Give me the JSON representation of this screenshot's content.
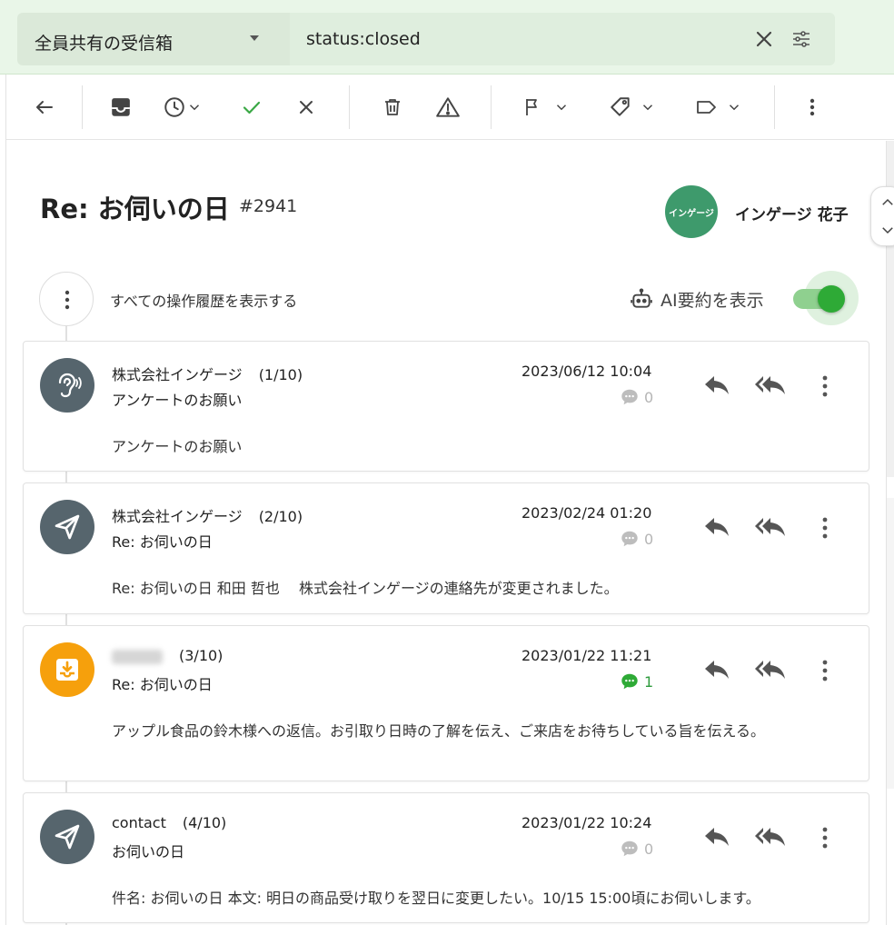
{
  "search": {
    "inbox": "全員共有の受信箱",
    "query": "status:closed"
  },
  "ticket": {
    "title": "Re: お伺いの日",
    "number": "#2941",
    "assignee_badge": "インゲージ",
    "assignee_name": "インゲージ 花子"
  },
  "timeline": {
    "history_label": "すべての操作履歴を表示する",
    "ai_label": "AI要約を表示",
    "ai_enabled": true
  },
  "messages": [
    {
      "sender": "株式会社インゲージ",
      "count": "(1/10)",
      "subject": "アンケートのお願い",
      "date": "2023/06/12 10:04",
      "comments": "0",
      "body": "アンケートのお願い",
      "icon": "ear-icon",
      "avatar_color": "#56656d"
    },
    {
      "sender": "株式会社インゲージ",
      "count": "(2/10)",
      "subject": "Re: お伺いの日",
      "date": "2023/02/24 01:20",
      "comments": "0",
      "body": "Re: お伺いの日 和田 哲也　 株式会社インゲージの連絡先が変更されました。",
      "icon": "send-icon",
      "avatar_color": "#56656d"
    },
    {
      "sender": "",
      "count": "(3/10)",
      "subject": "Re: お伺いの日",
      "date": "2023/01/22 11:21",
      "comments": "1",
      "body": "アップル食品の鈴木様への返信。お引取り日時の了解を伝え、ご来店をお待ちしている旨を伝える。",
      "icon": "inbox-download-icon",
      "avatar_color": "#f6a00c"
    },
    {
      "sender": "contact",
      "count": "(4/10)",
      "subject": "お伺いの日",
      "date": "2023/01/22 10:24",
      "comments": "0",
      "body": "件名: お伺いの日 本文: 明日の商品受け取りを翌日に変更したい。10/15 15:00頃にお伺いします。",
      "icon": "send-icon",
      "avatar_color": "#56656d"
    }
  ],
  "colors": {
    "accent_green": "#2eaa36",
    "topbar_bg": "#e9f6e8",
    "avatar_slate": "#56656d",
    "avatar_orange": "#f6a00c",
    "assignee_green": "#3e9a6c"
  }
}
